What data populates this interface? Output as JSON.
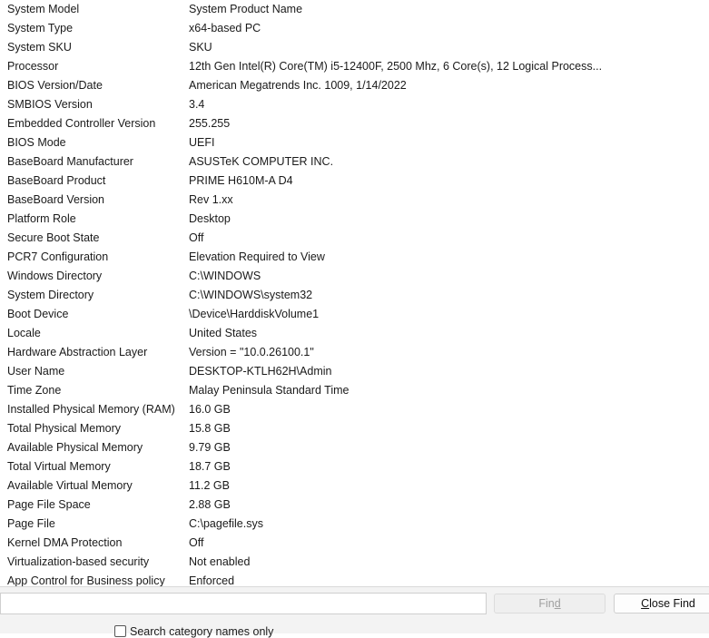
{
  "rows": [
    {
      "item": "System Model",
      "value": "System Product Name"
    },
    {
      "item": "System Type",
      "value": "x64-based PC"
    },
    {
      "item": "System SKU",
      "value": "SKU"
    },
    {
      "item": "Processor",
      "value": "12th Gen Intel(R) Core(TM) i5-12400F, 2500 Mhz, 6 Core(s), 12 Logical Process..."
    },
    {
      "item": "BIOS Version/Date",
      "value": "American Megatrends Inc. 1009, 1/14/2022"
    },
    {
      "item": "SMBIOS Version",
      "value": "3.4"
    },
    {
      "item": "Embedded Controller Version",
      "value": "255.255"
    },
    {
      "item": "BIOS Mode",
      "value": "UEFI"
    },
    {
      "item": "BaseBoard Manufacturer",
      "value": "ASUSTeK COMPUTER INC."
    },
    {
      "item": "BaseBoard Product",
      "value": "PRIME H610M-A D4"
    },
    {
      "item": "BaseBoard Version",
      "value": "Rev 1.xx"
    },
    {
      "item": "Platform Role",
      "value": "Desktop"
    },
    {
      "item": "Secure Boot State",
      "value": "Off"
    },
    {
      "item": "PCR7 Configuration",
      "value": "Elevation Required to View"
    },
    {
      "item": "Windows Directory",
      "value": "C:\\WINDOWS"
    },
    {
      "item": "System Directory",
      "value": "C:\\WINDOWS\\system32"
    },
    {
      "item": "Boot Device",
      "value": "\\Device\\HarddiskVolume1"
    },
    {
      "item": "Locale",
      "value": "United States"
    },
    {
      "item": "Hardware Abstraction Layer",
      "value": "Version = \"10.0.26100.1\""
    },
    {
      "item": "User Name",
      "value": "DESKTOP-KTLH62H\\Admin"
    },
    {
      "item": "Time Zone",
      "value": "Malay Peninsula Standard Time"
    },
    {
      "item": "Installed Physical Memory (RAM)",
      "value": "16.0 GB"
    },
    {
      "item": "Total Physical Memory",
      "value": "15.8 GB"
    },
    {
      "item": "Available Physical Memory",
      "value": "9.79 GB"
    },
    {
      "item": "Total Virtual Memory",
      "value": "18.7 GB"
    },
    {
      "item": "Available Virtual Memory",
      "value": "11.2 GB"
    },
    {
      "item": "Page File Space",
      "value": "2.88 GB"
    },
    {
      "item": "Page File",
      "value": "C:\\pagefile.sys"
    },
    {
      "item": "Kernel DMA Protection",
      "value": "Off"
    },
    {
      "item": "Virtualization-based security",
      "value": "Not enabled"
    },
    {
      "item": "App Control for Business policy",
      "value": "Enforced"
    }
  ],
  "find_bar": {
    "find_label": "Find",
    "close_find_label": "Close Find",
    "search_category_label": "Search category names only"
  }
}
